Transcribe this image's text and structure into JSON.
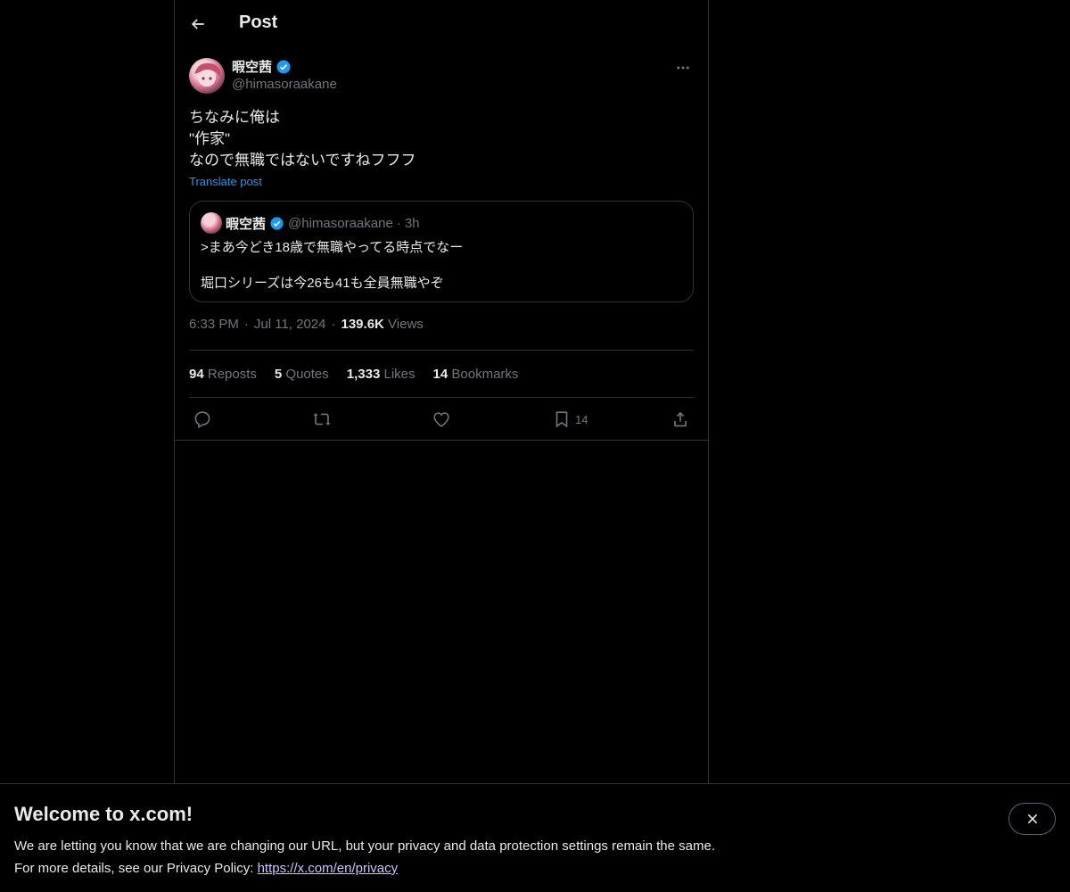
{
  "header": {
    "title": "Post"
  },
  "post": {
    "author_name": "暇空茜",
    "author_handle": "@himasoraakane",
    "text_lines": [
      "ちなみに俺は",
      "\"作家\"",
      "なので無職ではないですねフフフ"
    ],
    "translate_label": "Translate post",
    "quote": {
      "author_name": "暇空茜",
      "author_handle": "@himasoraakane",
      "dot": "·",
      "time": "3h",
      "line1": ">まあ今どき18歳で無職やってる時点でなー",
      "line2": "堀口シリーズは今26も41も全員無職やぞ"
    },
    "time": "6:33 PM",
    "date": "Jul 11, 2024",
    "sep": "·",
    "views_count": "139.6K",
    "views_label": "Views"
  },
  "stats": {
    "reposts_count": "94",
    "reposts_label": "Reposts",
    "quotes_count": "5",
    "quotes_label": "Quotes",
    "likes_count": "1,333",
    "likes_label": "Likes",
    "bookmarks_count": "14",
    "bookmarks_label": "Bookmarks"
  },
  "actions": {
    "bookmark_count": "14"
  },
  "banner": {
    "title": "Welcome to x.com!",
    "line1": "We are letting you know that we are changing our URL, but your privacy and data protection settings remain the same.",
    "line2_prefix": "For more details, see our Privacy Policy: ",
    "link": "https://x.com/en/privacy"
  },
  "colors": {
    "accent": "#1d9bf0",
    "background": "#000000",
    "border": "#2f3336",
    "muted": "#71767b"
  },
  "icons": [
    "arrow-left-icon",
    "verified-badge-icon",
    "more-icon",
    "reply-icon",
    "repost-icon",
    "like-icon",
    "bookmark-icon",
    "share-icon",
    "close-icon"
  ]
}
